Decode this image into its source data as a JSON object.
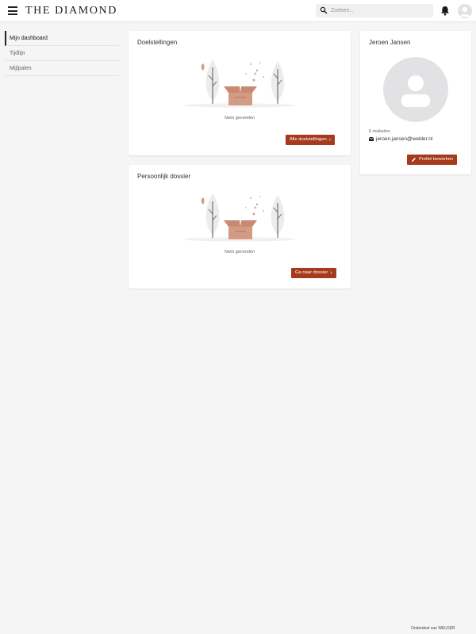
{
  "header": {
    "brand": "THE DIAMOND",
    "search_placeholder": "Zoeken..."
  },
  "sidebar": {
    "items": [
      {
        "label": "Mijn dashboard",
        "active": true
      },
      {
        "label": "Tijdlijn",
        "active": false
      },
      {
        "label": "Mijlpalen",
        "active": false
      }
    ]
  },
  "goals_card": {
    "title": "Doelstellingen",
    "empty_text": "Niets gevonden",
    "button_label": "Alle doelstellingen"
  },
  "dossier_card": {
    "title": "Persoonlijk dossier",
    "empty_text": "Niets gevonden",
    "button_label": "Ga naar dossier"
  },
  "profile_card": {
    "name": "Jeroen Jansen",
    "email_label": "E-mailadres",
    "email": "jeroen.jansen@welder.nl",
    "button_label": "Profiel bewerken"
  },
  "footer": {
    "text": "Onderdeel van WELDER"
  },
  "colors": {
    "accent": "#a53a1c",
    "background": "#f5f5f5",
    "illustration_box": "#d39a84"
  }
}
